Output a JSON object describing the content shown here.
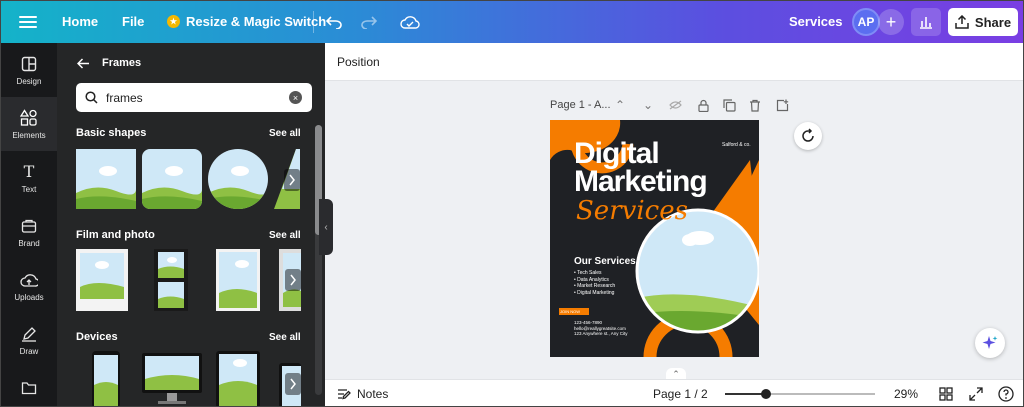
{
  "topbar": {
    "home": "Home",
    "file": "File",
    "resize": "Resize & Magic Switch",
    "services": "Services",
    "avatar_initials": "AP",
    "share": "Share"
  },
  "rail": {
    "items": [
      {
        "label": "Design",
        "icon": "design-icon"
      },
      {
        "label": "Elements",
        "icon": "elements-icon"
      },
      {
        "label": "Text",
        "icon": "text-icon"
      },
      {
        "label": "Brand",
        "icon": "brand-icon"
      },
      {
        "label": "Uploads",
        "icon": "uploads-icon"
      },
      {
        "label": "Draw",
        "icon": "draw-icon"
      },
      {
        "label": "Projects",
        "icon": "folder-icon"
      }
    ]
  },
  "panel": {
    "title": "Frames",
    "search_value": "frames",
    "sections": [
      {
        "title": "Basic shapes",
        "see_all": "See all"
      },
      {
        "title": "Film and photo",
        "see_all": "See all"
      },
      {
        "title": "Devices",
        "see_all": "See all"
      }
    ]
  },
  "toolbar": {
    "position": "Position"
  },
  "page": {
    "label": "Page 1 - A..."
  },
  "design": {
    "brand": "Salford & co.",
    "title_line1": "Digital",
    "title_line2": "Marketing",
    "title_script": "Services",
    "services_heading": "Our Services",
    "services": [
      "Tech Sales",
      "Data Analytics",
      "Market Research",
      "Digital Marketing"
    ],
    "cta": "JOIN NOW",
    "phone": "123-456-7890",
    "email": "hello@reallygreatsite.com",
    "address": "123 Anywhere st., Any City",
    "accent": "#f57c00",
    "background": "#1f2125"
  },
  "bottombar": {
    "notes": "Notes",
    "page_info": "Page 1 / 2",
    "zoom": "29%",
    "zoom_fraction": 0.27
  }
}
